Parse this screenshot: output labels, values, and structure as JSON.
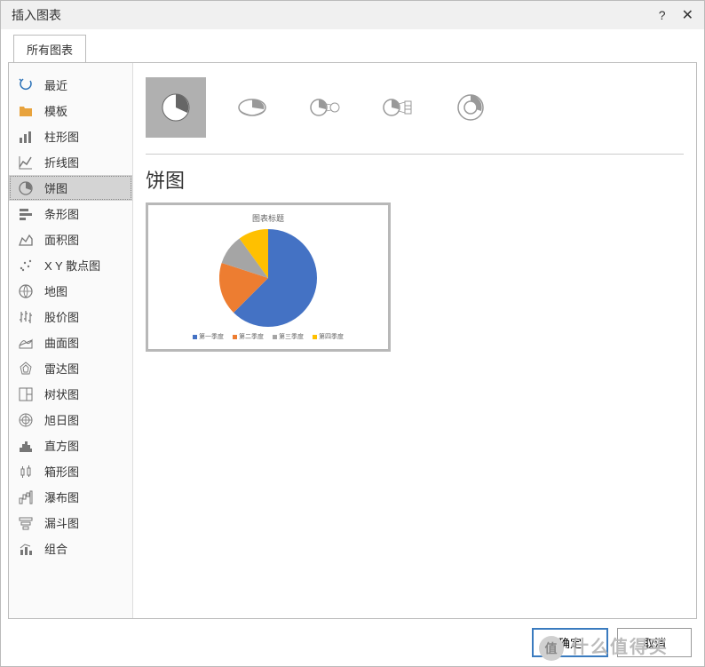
{
  "dialog": {
    "title": "插入图表"
  },
  "tabs": {
    "all": "所有图表"
  },
  "sidebar": {
    "items": [
      {
        "label": "最近"
      },
      {
        "label": "模板"
      },
      {
        "label": "柱形图"
      },
      {
        "label": "折线图"
      },
      {
        "label": "饼图"
      },
      {
        "label": "条形图"
      },
      {
        "label": "面积图"
      },
      {
        "label": "X Y 散点图"
      },
      {
        "label": "地图"
      },
      {
        "label": "股价图"
      },
      {
        "label": "曲面图"
      },
      {
        "label": "雷达图"
      },
      {
        "label": "树状图"
      },
      {
        "label": "旭日图"
      },
      {
        "label": "直方图"
      },
      {
        "label": "箱形图"
      },
      {
        "label": "瀑布图"
      },
      {
        "label": "漏斗图"
      },
      {
        "label": "组合"
      }
    ]
  },
  "main": {
    "subtype_selected": 0,
    "chart_name": "饼图",
    "preview_title": "图表标题"
  },
  "chart_data": {
    "type": "pie",
    "title": "图表标题",
    "categories": [
      "第一季度",
      "第二季度",
      "第三季度",
      "第四季度"
    ],
    "values": [
      50,
      25,
      15,
      10
    ],
    "colors": [
      "#4472C4",
      "#ED7D31",
      "#A5A5A5",
      "#FFC000"
    ]
  },
  "footer": {
    "ok": "确定",
    "cancel": "取消"
  },
  "watermark": "什么值得买"
}
